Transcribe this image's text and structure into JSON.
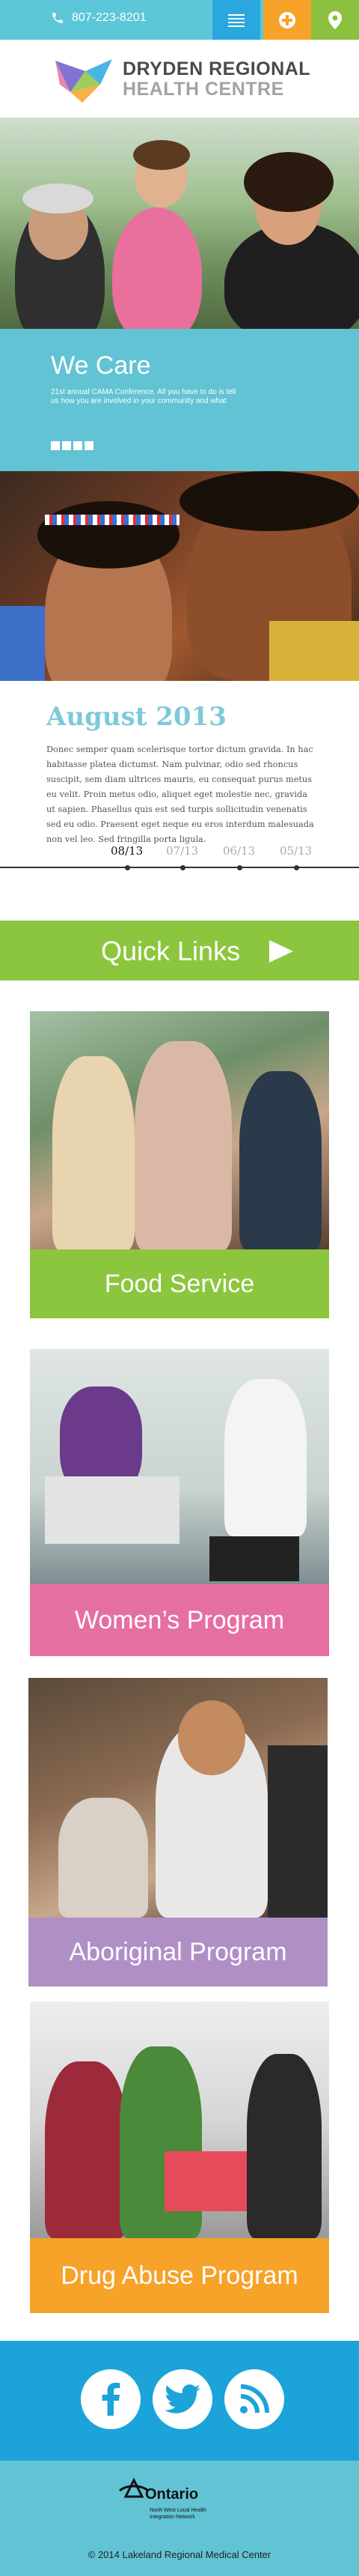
{
  "header": {
    "phone": "807-223-8201",
    "icons": {
      "phone": "phone-icon",
      "menu": "hamburger-icon",
      "plus": "plus-icon",
      "location": "location-pin-icon"
    },
    "colors": {
      "bar": "#5bc7d8",
      "menu": "#2aa7de",
      "plus": "#f7a229",
      "location": "#8cc03f"
    }
  },
  "logo": {
    "line1": "DRYDEN REGIONAL",
    "line2": "HEALTH CENTRE"
  },
  "care": {
    "title": "We Care",
    "text": "21st annual CAMA Conference.  All you have to do is tell us how you are involved in your community and what"
  },
  "news": {
    "title": "August 2013",
    "body": "Donec semper quam scelerisque tortor dictum gravida. In hac habitasse platea dictumst. Nam pulvinar, odio sed rhoncus suscipit, sem diam ultrices mauris, eu consequat purus metus eu velit. Proin metus odio, aliquet eget molestie nec, gravida ut sapien. Phasellus quis est sed turpis sollicitudin venenatis sed eu odio. Praesent eget neque eu eros interdum malesuada non vel leo. Sed fringilla porta ligula.",
    "dates": [
      "08/13",
      "07/13",
      "06/13",
      "05/13"
    ]
  },
  "quick_links": {
    "label": "Quick Links"
  },
  "programs": [
    {
      "label": "Food Service",
      "color": "#8cc63e"
    },
    {
      "label": "Women’s Program",
      "color": "#e66fa2"
    },
    {
      "label": "Aboriginal Program",
      "color": "#b08fc6"
    },
    {
      "label": "Drug Abuse Program",
      "color": "#f7a229"
    }
  ],
  "social": {
    "icons": [
      "facebook-icon",
      "twitter-icon",
      "rss-icon"
    ]
  },
  "footer": {
    "ontario": "Ontario",
    "lhin": "North West Local Health Integration Network",
    "copyright": "© 2014 Lakeland Regional Medical Center"
  }
}
